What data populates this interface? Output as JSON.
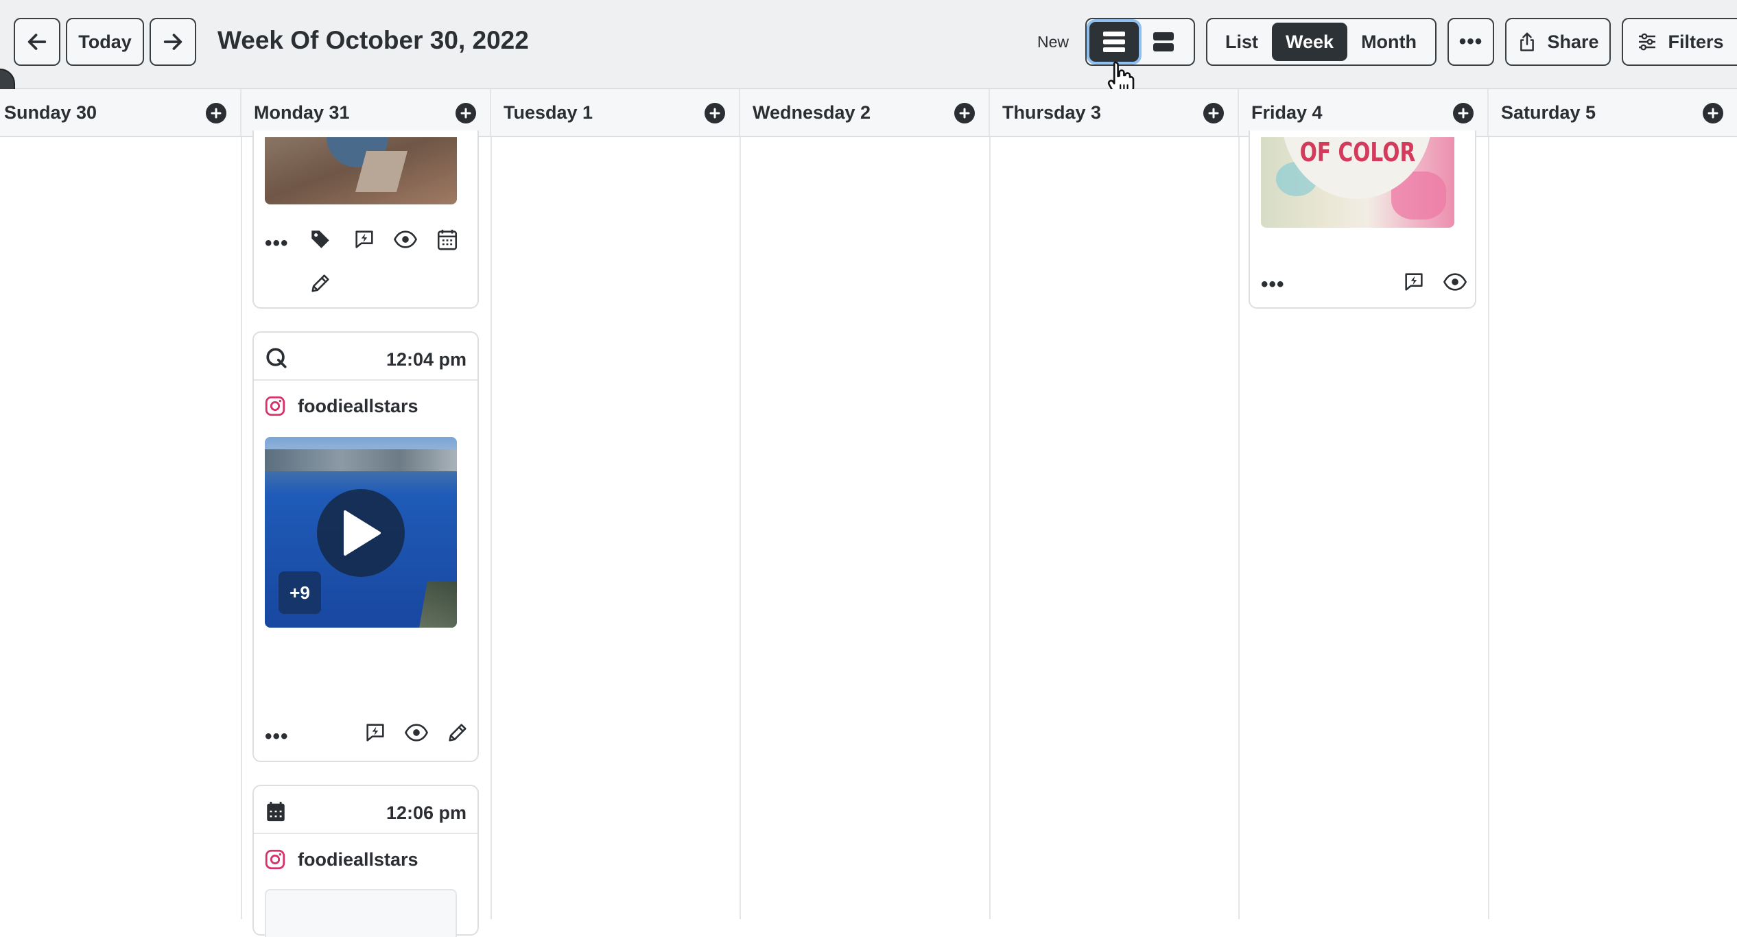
{
  "toolbar": {
    "today_label": "Today",
    "title": "Week Of October 30, 2022",
    "new_tag": "New",
    "view_options": [
      "List",
      "Week",
      "Month"
    ],
    "selected_view": "Week",
    "more_label": "•••",
    "share_label": "Share",
    "filters_label": "Filters"
  },
  "days": [
    {
      "label": "Sunday 30"
    },
    {
      "label": "Monday 31"
    },
    {
      "label": "Tuesday 1"
    },
    {
      "label": "Wednesday 2"
    },
    {
      "label": "Thursday 3"
    },
    {
      "label": "Friday 4"
    },
    {
      "label": "Saturday 5"
    }
  ],
  "posts": {
    "monday_top": {
      "more": "•••"
    },
    "monday_mid": {
      "time": "12:04 pm",
      "account": "foodieallstars",
      "media_count": "+9",
      "more": "•••"
    },
    "monday_bottom": {
      "time": "12:06 pm",
      "account": "foodieallstars"
    },
    "friday_top": {
      "image_text": "OF COLOR",
      "more": "•••"
    }
  },
  "colors": {
    "toolbar_bg": "#eef0f1",
    "active_dark": "#2d3236",
    "focus_ring": "#8fc0ef",
    "instagram": "#d6336c"
  }
}
